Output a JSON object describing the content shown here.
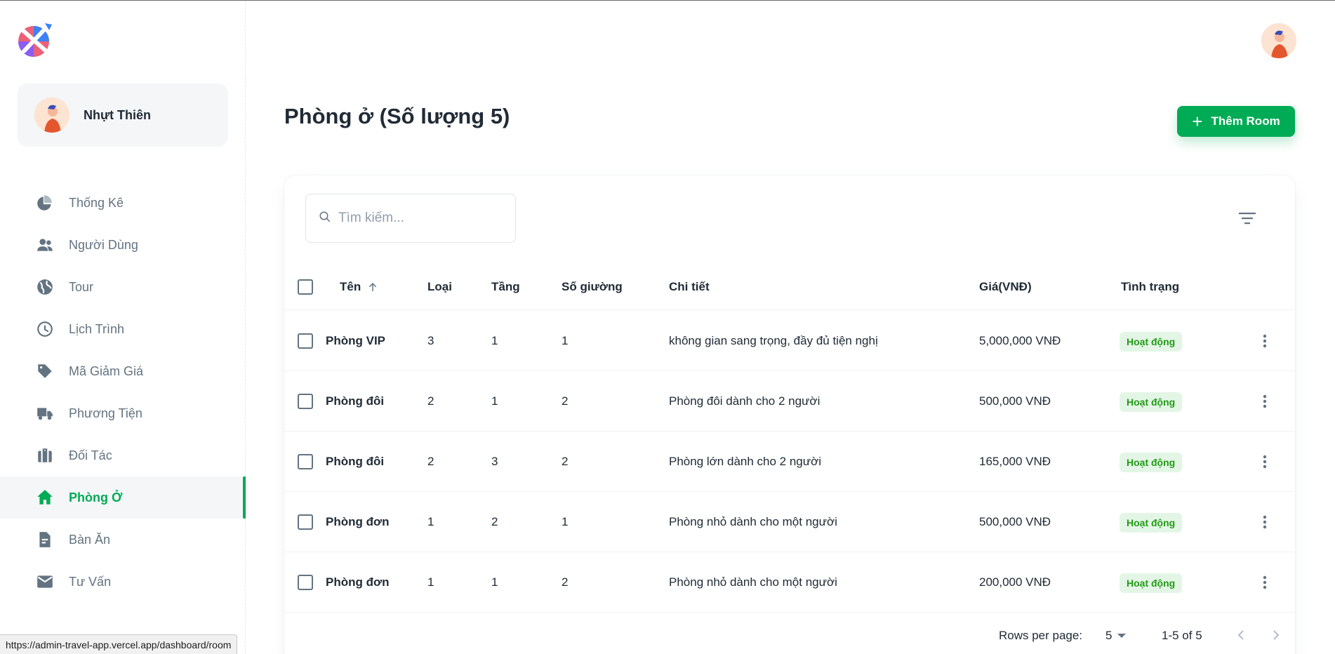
{
  "sidebar": {
    "user_name": "Nhựt Thiên",
    "items": [
      {
        "label": "Thống Kê",
        "icon": "pie-chart-icon",
        "active": false
      },
      {
        "label": "Người Dùng",
        "icon": "people-icon",
        "active": false
      },
      {
        "label": "Tour",
        "icon": "globe-icon",
        "active": false
      },
      {
        "label": "Lịch Trình",
        "icon": "clock-icon",
        "active": false
      },
      {
        "label": "Mã Giảm Giá",
        "icon": "tag-icon",
        "active": false
      },
      {
        "label": "Phương Tiện",
        "icon": "truck-icon",
        "active": false
      },
      {
        "label": "Đối Tác",
        "icon": "briefcase-icon",
        "active": false
      },
      {
        "label": "Phòng Ở",
        "icon": "home-icon",
        "active": true
      },
      {
        "label": "Bàn Ăn",
        "icon": "file-text-icon",
        "active": false
      },
      {
        "label": "Tư Vấn",
        "icon": "mail-icon",
        "active": false
      }
    ]
  },
  "page": {
    "title": "Phòng ở (Số lượng 5)",
    "add_button": "Thêm Room"
  },
  "search": {
    "placeholder": "Tìm kiếm..."
  },
  "table": {
    "columns": [
      "Tên",
      "Loại",
      "Tầng",
      "Số giường",
      "Chi tiết",
      "Giá(VNĐ)",
      "Tình trạng"
    ],
    "rows": [
      {
        "name": "Phòng VIP",
        "type": "3",
        "floor": "1",
        "beds": "1",
        "detail": "không gian sang trọng, đầy đủ tiện nghị",
        "price": "5,000,000 VNĐ",
        "status": "Hoạt động"
      },
      {
        "name": "Phòng đôi",
        "type": "2",
        "floor": "1",
        "beds": "2",
        "detail": "Phòng đôi dành cho 2 người",
        "price": "500,000 VNĐ",
        "status": "Hoạt động"
      },
      {
        "name": "Phòng đôi",
        "type": "2",
        "floor": "3",
        "beds": "2",
        "detail": "Phòng lớn dành cho 2 người",
        "price": "165,000 VNĐ",
        "status": "Hoạt động"
      },
      {
        "name": "Phòng đơn",
        "type": "1",
        "floor": "2",
        "beds": "1",
        "detail": "Phòng nhỏ dành cho một người",
        "price": "500,000 VNĐ",
        "status": "Hoạt động"
      },
      {
        "name": "Phòng đơn",
        "type": "1",
        "floor": "1",
        "beds": "2",
        "detail": "Phòng nhỏ dành cho một người",
        "price": "200,000 VNĐ",
        "status": "Hoạt động"
      }
    ]
  },
  "pagination": {
    "rows_per_page_label": "Rows per page:",
    "rows_per_page_value": "5",
    "range": "1-5 of 5"
  },
  "statusbar": {
    "url": "https://admin-travel-app.vercel.app/dashboard/room"
  },
  "colors": {
    "accent": "#00ab55",
    "badge_bg": "#e3f6e6",
    "badge_text": "#229a16",
    "nav_text": "#637381"
  }
}
